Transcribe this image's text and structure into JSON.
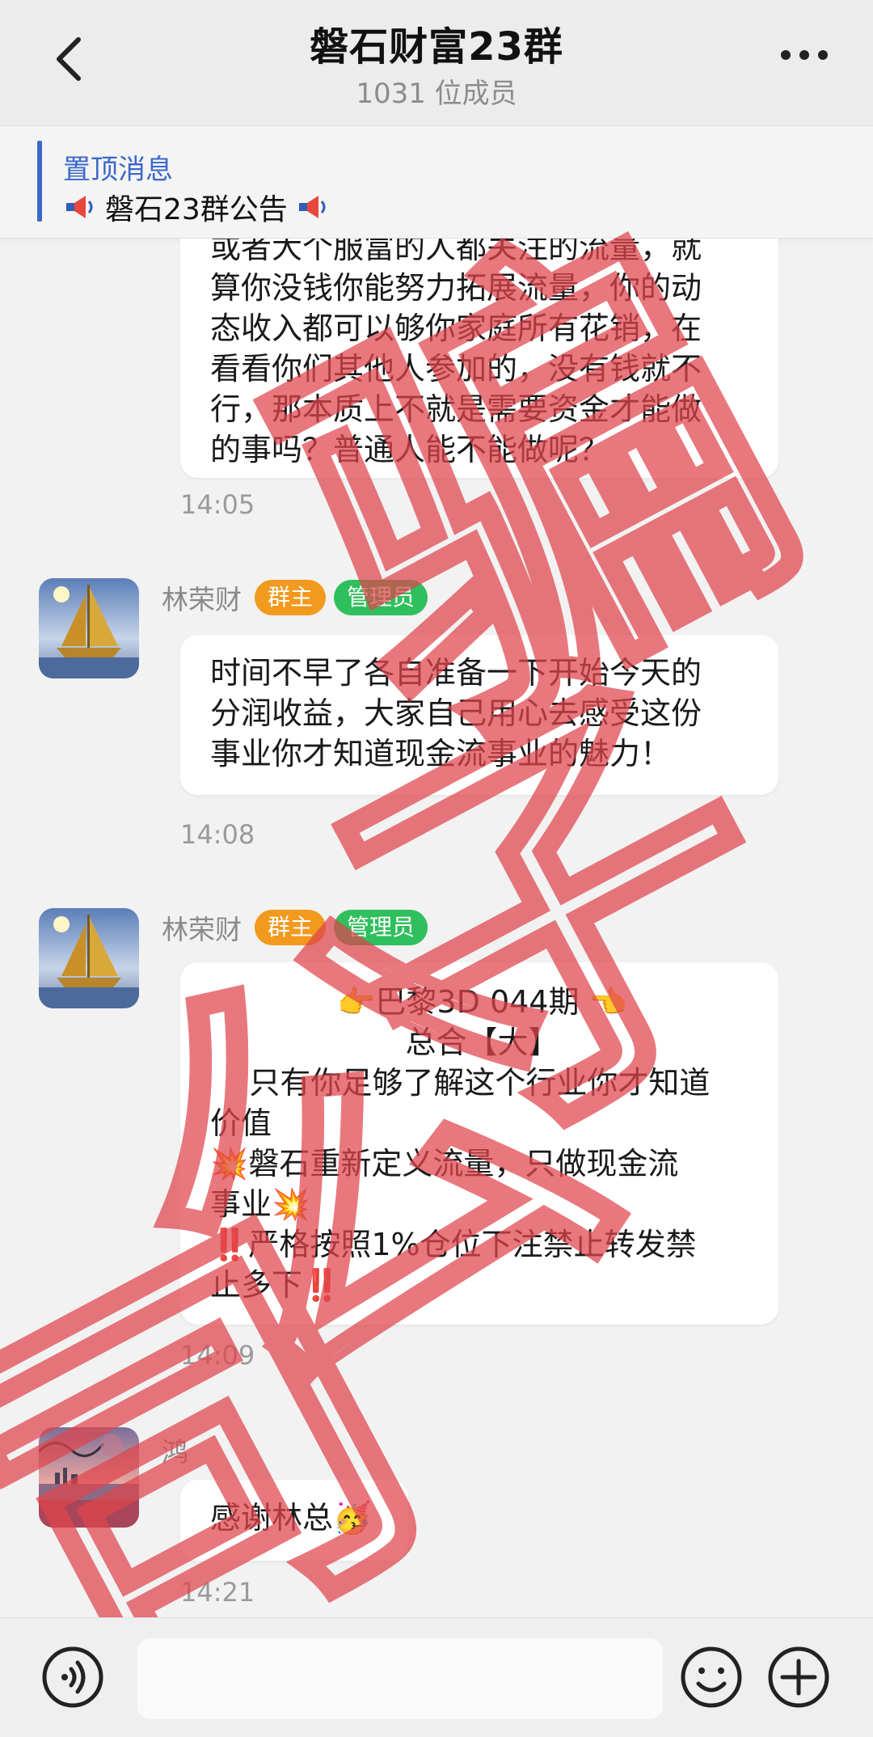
{
  "header": {
    "title": "磐石财富23群",
    "member_count": "1031 位成员"
  },
  "pinned": {
    "label": "置顶消息",
    "text": "磐石23群公告"
  },
  "messages": [
    {
      "lines": [
        "或者大个服富的人都关注的流量，就",
        "算你没钱你能努力拓展流量，你的动",
        "态收入都可以够你家庭所有花销，在",
        "看看你们其他人参加的，没有钱就不",
        "行，那本质上不就是需要资金才能做",
        "的事吗？普通人能不能做呢？"
      ],
      "time": "14:05"
    },
    {
      "sender": "林荣财",
      "tags": [
        "群主",
        "管理员"
      ],
      "lines": [
        "时间不早了各自准备一下开始今天的",
        "分润收益，大家自己用心去感受这份",
        "事业你才知道现金流事业的魅力！"
      ],
      "time": "14:08"
    },
    {
      "sender": "林荣财",
      "tags": [
        "群主",
        "管理员"
      ],
      "lines": [
        "👉巴黎3D   044期   👈",
        "总合【大】",
        "    只有你足够了解这个行业你才知道",
        "价值",
        "💥磐石重新定义流量，只做现金流",
        "事业💥",
        "‼️严格按照1%仓位下注禁止转发禁",
        "止多下‼️"
      ],
      "time": "14:09"
    },
    {
      "sender": "鸿",
      "lines": [
        "感谢林总🥳"
      ],
      "time": "14:21"
    }
  ],
  "watermark": "骗子公司",
  "icons": [
    "back-arrow-icon",
    "more-icon",
    "megaphone-icon",
    "voice-icon",
    "emoji-icon",
    "plus-icon"
  ],
  "colors": {
    "pinned_accent": "#3b68c9",
    "owner_tag": "#f19a1e",
    "admin_tag": "#2fbf5d",
    "watermark": "#e0454c"
  }
}
